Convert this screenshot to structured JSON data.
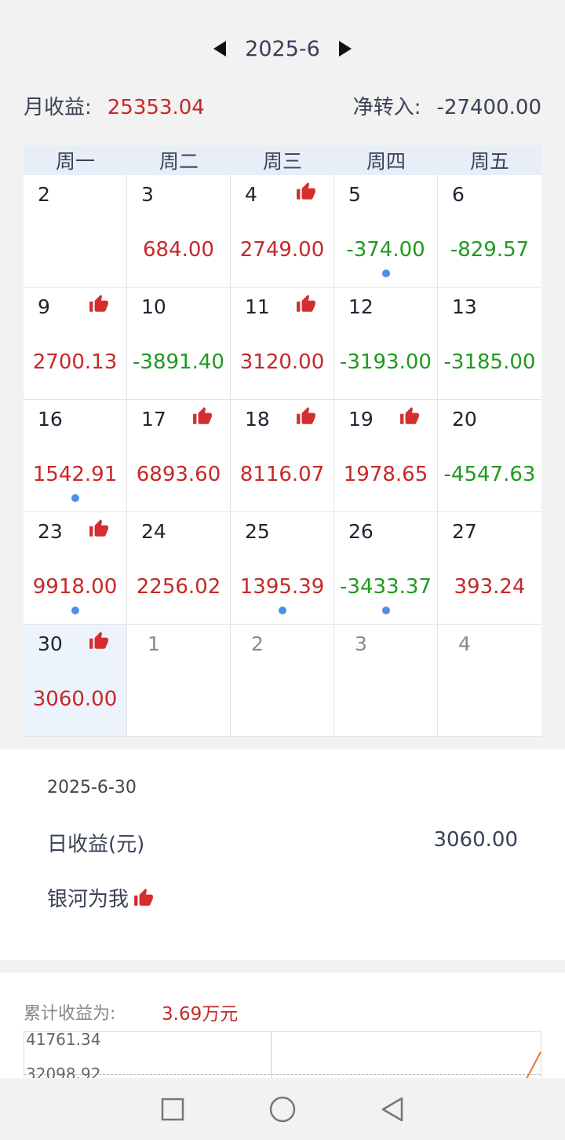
{
  "header": {
    "month": "2025-6"
  },
  "summary": {
    "month_income_label": "月收益:",
    "month_income": "25353.04",
    "net_transfer_label": "净转入:",
    "net_transfer": "-27400.00"
  },
  "calendar": {
    "weekdays": [
      "周一",
      "周二",
      "周三",
      "周四",
      "周五"
    ],
    "days": [
      {
        "day": "2",
        "value": "",
        "type": "",
        "thumb": false,
        "dot": false
      },
      {
        "day": "3",
        "value": "684.00",
        "type": "pos",
        "thumb": false,
        "dot": false
      },
      {
        "day": "4",
        "value": "2749.00",
        "type": "pos",
        "thumb": true,
        "dot": false
      },
      {
        "day": "5",
        "value": "-374.00",
        "type": "neg",
        "thumb": false,
        "dot": true
      },
      {
        "day": "6",
        "value": "-829.57",
        "type": "neg",
        "thumb": false,
        "dot": false
      },
      {
        "day": "9",
        "value": "2700.13",
        "type": "pos",
        "thumb": true,
        "dot": false
      },
      {
        "day": "10",
        "value": "-3891.40",
        "type": "neg",
        "thumb": false,
        "dot": false
      },
      {
        "day": "11",
        "value": "3120.00",
        "type": "pos",
        "thumb": true,
        "dot": false
      },
      {
        "day": "12",
        "value": "-3193.00",
        "type": "neg",
        "thumb": false,
        "dot": false
      },
      {
        "day": "13",
        "value": "-3185.00",
        "type": "neg",
        "thumb": false,
        "dot": false
      },
      {
        "day": "16",
        "value": "1542.91",
        "type": "pos",
        "thumb": false,
        "dot": true
      },
      {
        "day": "17",
        "value": "6893.60",
        "type": "pos",
        "thumb": true,
        "dot": false
      },
      {
        "day": "18",
        "value": "8116.07",
        "type": "pos",
        "thumb": true,
        "dot": false
      },
      {
        "day": "19",
        "value": "1978.65",
        "type": "pos",
        "thumb": true,
        "dot": false
      },
      {
        "day": "20",
        "value": "-4547.63",
        "type": "neg",
        "thumb": false,
        "dot": false
      },
      {
        "day": "23",
        "value": "9918.00",
        "type": "pos",
        "thumb": true,
        "dot": true
      },
      {
        "day": "24",
        "value": "2256.02",
        "type": "pos",
        "thumb": false,
        "dot": false
      },
      {
        "day": "25",
        "value": "1395.39",
        "type": "pos",
        "thumb": false,
        "dot": true
      },
      {
        "day": "26",
        "value": "-3433.37",
        "type": "neg",
        "thumb": false,
        "dot": true
      },
      {
        "day": "27",
        "value": "393.24",
        "type": "pos",
        "thumb": false,
        "dot": false
      },
      {
        "day": "30",
        "value": "3060.00",
        "type": "pos",
        "thumb": true,
        "dot": false,
        "selected": true
      },
      {
        "day": "1",
        "value": "",
        "type": "",
        "thumb": false,
        "dot": false,
        "other": true
      },
      {
        "day": "2",
        "value": "",
        "type": "",
        "thumb": false,
        "dot": false,
        "other": true
      },
      {
        "day": "3",
        "value": "",
        "type": "",
        "thumb": false,
        "dot": false,
        "other": true
      },
      {
        "day": "4",
        "value": "",
        "type": "",
        "thumb": false,
        "dot": false,
        "other": true
      }
    ]
  },
  "detail": {
    "date": "2025-6-30",
    "income_label": "日收益(元)",
    "income_value": "3060.00",
    "name": "银河为我"
  },
  "cumulative": {
    "label": "累计收益为:",
    "value": "3.69万元",
    "y_ticks": [
      "41761.34",
      "32098.92"
    ]
  },
  "colors": {
    "positive": "#c62828",
    "negative": "#1f9a1f",
    "dot": "#4f8fe3",
    "thumb": "#d32f2f"
  },
  "icons": {
    "prev": "triangle-left-icon",
    "next": "triangle-right-icon",
    "thumb": "thumbs-up-icon",
    "nav": [
      "square-icon",
      "circle-icon",
      "back-triangle-icon"
    ]
  }
}
